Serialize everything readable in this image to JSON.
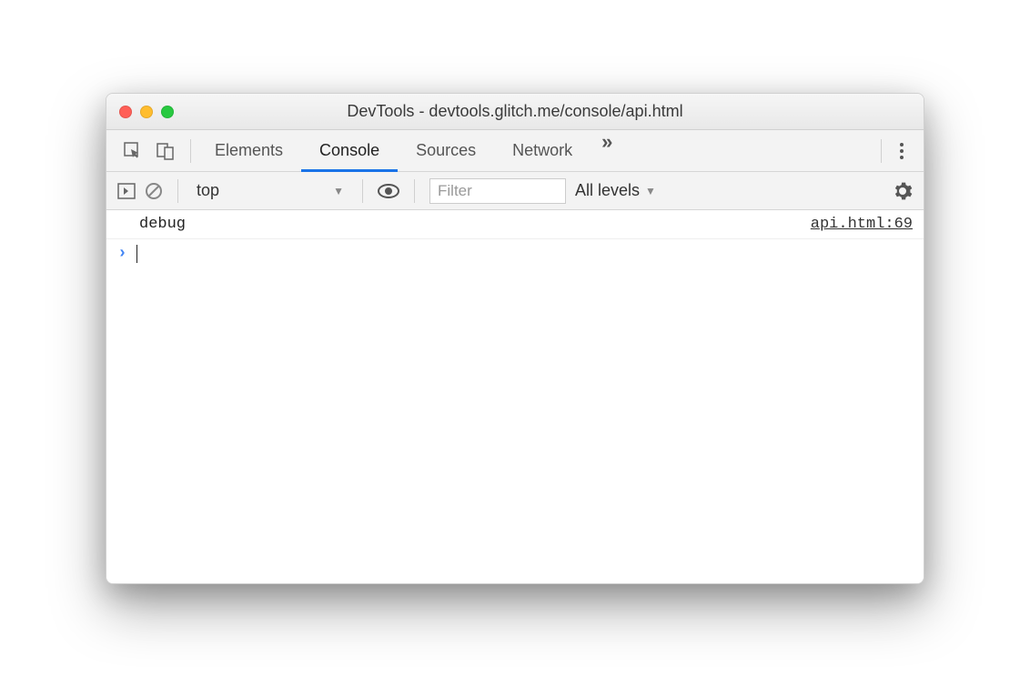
{
  "window": {
    "title": "DevTools - devtools.glitch.me/console/api.html"
  },
  "tabs": {
    "items": [
      "Elements",
      "Console",
      "Sources",
      "Network"
    ],
    "active": "Console"
  },
  "toolbar": {
    "context": "top",
    "filter_placeholder": "Filter",
    "levels_label": "All levels"
  },
  "console": {
    "logs": [
      {
        "message": "debug",
        "source": "api.html:69"
      }
    ]
  }
}
